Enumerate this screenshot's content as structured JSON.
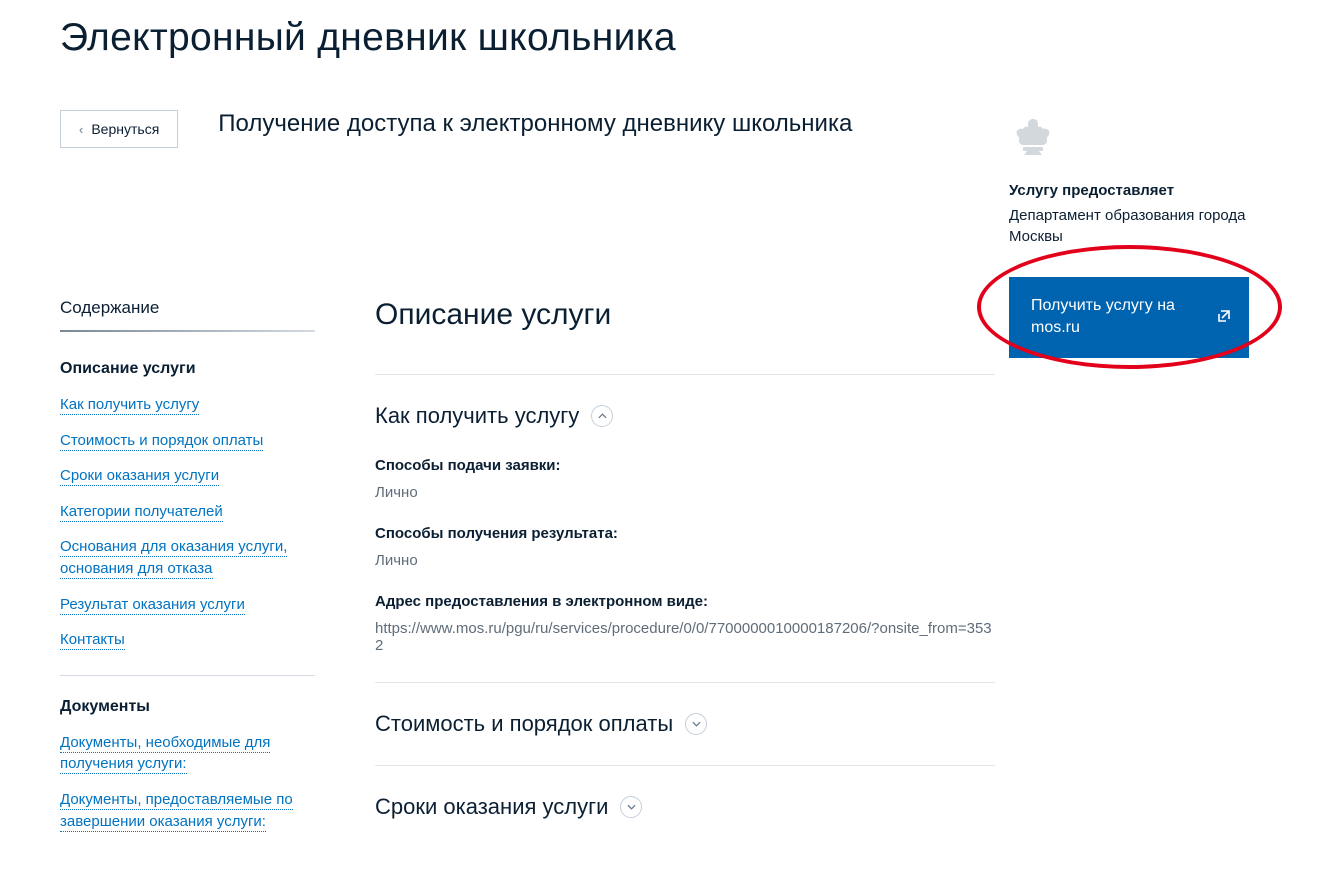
{
  "page_title": "Электронный дневник школьника",
  "back_label": "Вернуться",
  "sub_title": "Получение доступа к электронному дневнику школьника",
  "sidebar": {
    "heading": "Содержание",
    "group1_title": "Описание услуги",
    "group1_items": [
      "Как получить услугу",
      "Стоимость и порядок оплаты",
      "Сроки оказания услуги",
      "Категории получателей",
      "Основания для оказания услуги, основания для отказа",
      "Результат оказания услуги",
      "Контакты"
    ],
    "group2_title": "Документы",
    "group2_items": [
      "Документы, необходимые для получения услуги:",
      "Документы, предоставляемые по завершении оказания услуги:"
    ]
  },
  "main": {
    "section_title": "Описание услуги",
    "how_to": {
      "heading": "Как получить услугу",
      "apply_label": "Способы подачи заявки:",
      "apply_value": "Лично",
      "result_label": "Способы получения результата:",
      "result_value": "Лично",
      "addr_label": "Адрес предоставления в электронном виде:",
      "addr_value": "https://www.mos.ru/pgu/ru/services/procedure/0/0/7700000010000187206/?onsite_from=3532"
    },
    "cost_heading": "Стоимость и порядок оплаты",
    "terms_heading": "Сроки оказания услуги"
  },
  "right": {
    "provider_label": "Услугу предоставляет",
    "provider_name": "Департамент образования города Москвы",
    "cta_label": "Получить услугу на mos.ru"
  }
}
